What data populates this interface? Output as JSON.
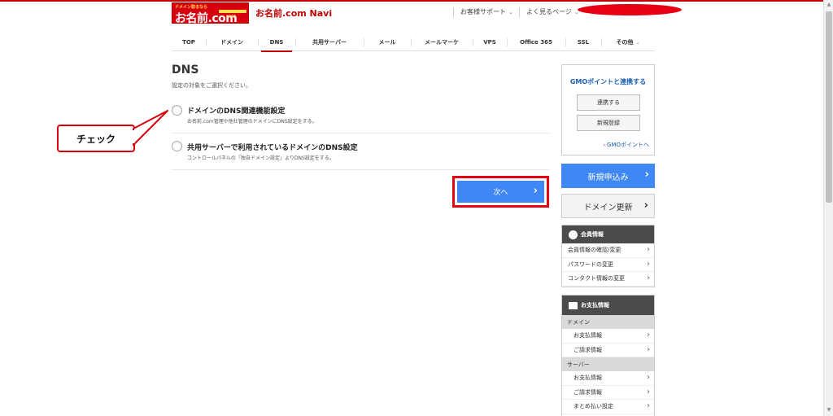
{
  "header": {
    "logo_tagline": "ドメイン取るなら",
    "logo_text": "お名前.com",
    "logo_sub": "GMO",
    "title": "お名前.com Navi",
    "support_label": "お客様サポート",
    "faq_label": "よく見るページ",
    "accent": "#c00000"
  },
  "nav": {
    "tabs": [
      {
        "label": "TOP"
      },
      {
        "label": "ドメイン"
      },
      {
        "label": "DNS",
        "active": true
      },
      {
        "label": "共用サーバー"
      },
      {
        "label": "メール"
      },
      {
        "label": "メールマーケ"
      },
      {
        "label": "VPS"
      },
      {
        "label": "Office 365"
      },
      {
        "label": "SSL"
      },
      {
        "label": "その他"
      }
    ]
  },
  "main": {
    "heading": "DNS",
    "instruction": "設定の対象をご選択ください。",
    "options": [
      {
        "title": "ドメインのDNS関連機能設定",
        "desc": "お名前.com管理や他社管理のドメインにDNS設定をする。"
      },
      {
        "title": "共用サーバーで利用されているドメインのDNS設定",
        "desc": "コントロールパネルの「独自ドメイン設定」よりDNS設定をする。"
      }
    ],
    "next_label": "次へ",
    "callout": "チェック"
  },
  "sidebar": {
    "gmo_title": "GMOポイントと連携する",
    "link_button": "連携する",
    "register_button": "新規登録",
    "gmo_link": "GMOポイントへ",
    "new_apply": "新規申込み",
    "renew": "ドメイン更新",
    "member": {
      "title": "会員情報",
      "items": [
        "会員情報の確認/変更",
        "パスワードの変更",
        "コンタクト情報の変更"
      ]
    },
    "payment": {
      "title": "お支払情報",
      "domain_cat": "ドメイン",
      "domain_items": [
        "お支払情報",
        "ご請求情報"
      ],
      "server_cat": "サーバー",
      "server_items": [
        "お支払情報",
        "ご請求情報",
        "まとめ払い設定"
      ]
    }
  }
}
